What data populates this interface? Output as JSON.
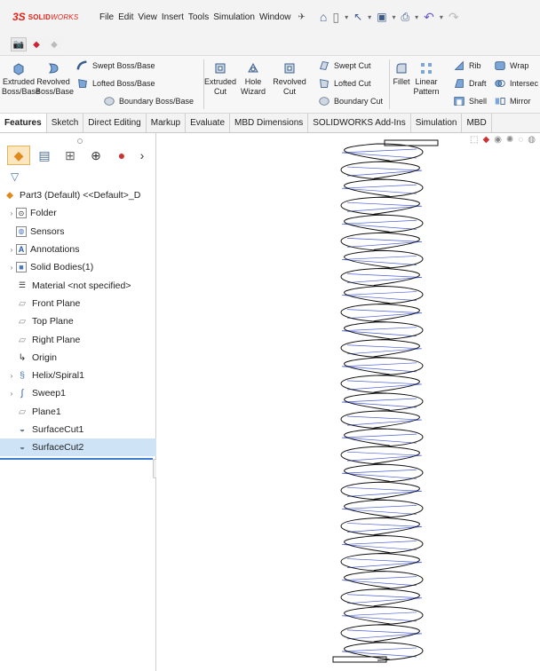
{
  "app": {
    "logo_prefix": "3S",
    "logo_bold": "SOLID",
    "logo_light": "WORKS"
  },
  "menu": [
    "File",
    "Edit",
    "View",
    "Insert",
    "Tools",
    "Simulation",
    "Window"
  ],
  "quick_access": [
    "home-icon",
    "new-document-icon",
    "select-pointer-icon",
    "save-icon",
    "print-icon",
    "undo-icon",
    "redo-icon"
  ],
  "ribbon": {
    "extruded_boss": "Extruded\nBoss/Base",
    "revolved_boss": "Revolved\nBoss/Base",
    "swept_boss": "Swept Boss/Base",
    "lofted_boss": "Lofted Boss/Base",
    "boundary_boss": "Boundary Boss/Base",
    "extruded_cut": "Extruded\nCut",
    "hole_wizard": "Hole\nWizard",
    "revolved_cut": "Revolved\nCut",
    "swept_cut": "Swept Cut",
    "lofted_cut": "Lofted Cut",
    "boundary_cut": "Boundary Cut",
    "fillet": "Fillet",
    "linear_pattern": "Linear\nPattern",
    "rib": "Rib",
    "draft": "Draft",
    "shell": "Shell",
    "wrap": "Wrap",
    "intersect": "Intersec",
    "mirror": "Mirror"
  },
  "tabs": [
    "Features",
    "Sketch",
    "Direct Editing",
    "Markup",
    "Evaluate",
    "MBD Dimensions",
    "SOLIDWORKS Add-Ins",
    "Simulation",
    "MBD"
  ],
  "active_tab": "Features",
  "tree": [
    {
      "label": "Part3 (Default) <<Default>_D",
      "icon": "part-icon",
      "expand": false,
      "level": 0
    },
    {
      "label": "Folder",
      "icon": "folder-icon",
      "expand": true,
      "level": 1
    },
    {
      "label": "Sensors",
      "icon": "sensors-icon",
      "expand": false,
      "level": 1
    },
    {
      "label": "Annotations",
      "icon": "annotations-icon",
      "expand": true,
      "level": 1
    },
    {
      "label": "Solid Bodies(1)",
      "icon": "solid-bodies-icon",
      "expand": true,
      "level": 1
    },
    {
      "label": "Material <not specified>",
      "icon": "material-icon",
      "expand": false,
      "level": 1
    },
    {
      "label": "Front Plane",
      "icon": "plane-icon",
      "expand": false,
      "level": 1
    },
    {
      "label": "Top Plane",
      "icon": "plane-icon",
      "expand": false,
      "level": 1
    },
    {
      "label": "Right Plane",
      "icon": "plane-icon",
      "expand": false,
      "level": 1
    },
    {
      "label": "Origin",
      "icon": "origin-icon",
      "expand": false,
      "level": 1
    },
    {
      "label": "Helix/Spiral1",
      "icon": "helix-icon",
      "expand": true,
      "level": 1
    },
    {
      "label": "Sweep1",
      "icon": "sweep-icon",
      "expand": true,
      "level": 1
    },
    {
      "label": "Plane1",
      "icon": "plane-icon",
      "expand": false,
      "level": 1
    },
    {
      "label": "SurfaceCut1",
      "icon": "surface-cut-icon",
      "expand": false,
      "level": 1
    },
    {
      "label": "SurfaceCut2",
      "icon": "surface-cut-icon",
      "expand": false,
      "level": 1,
      "selected": true
    }
  ],
  "colors": {
    "accent": "#3b7bd0",
    "brand": "#e2231a",
    "spring_outline": "#111111",
    "spring_path": "#4a5fd6",
    "selection": "#cfe3f7"
  }
}
